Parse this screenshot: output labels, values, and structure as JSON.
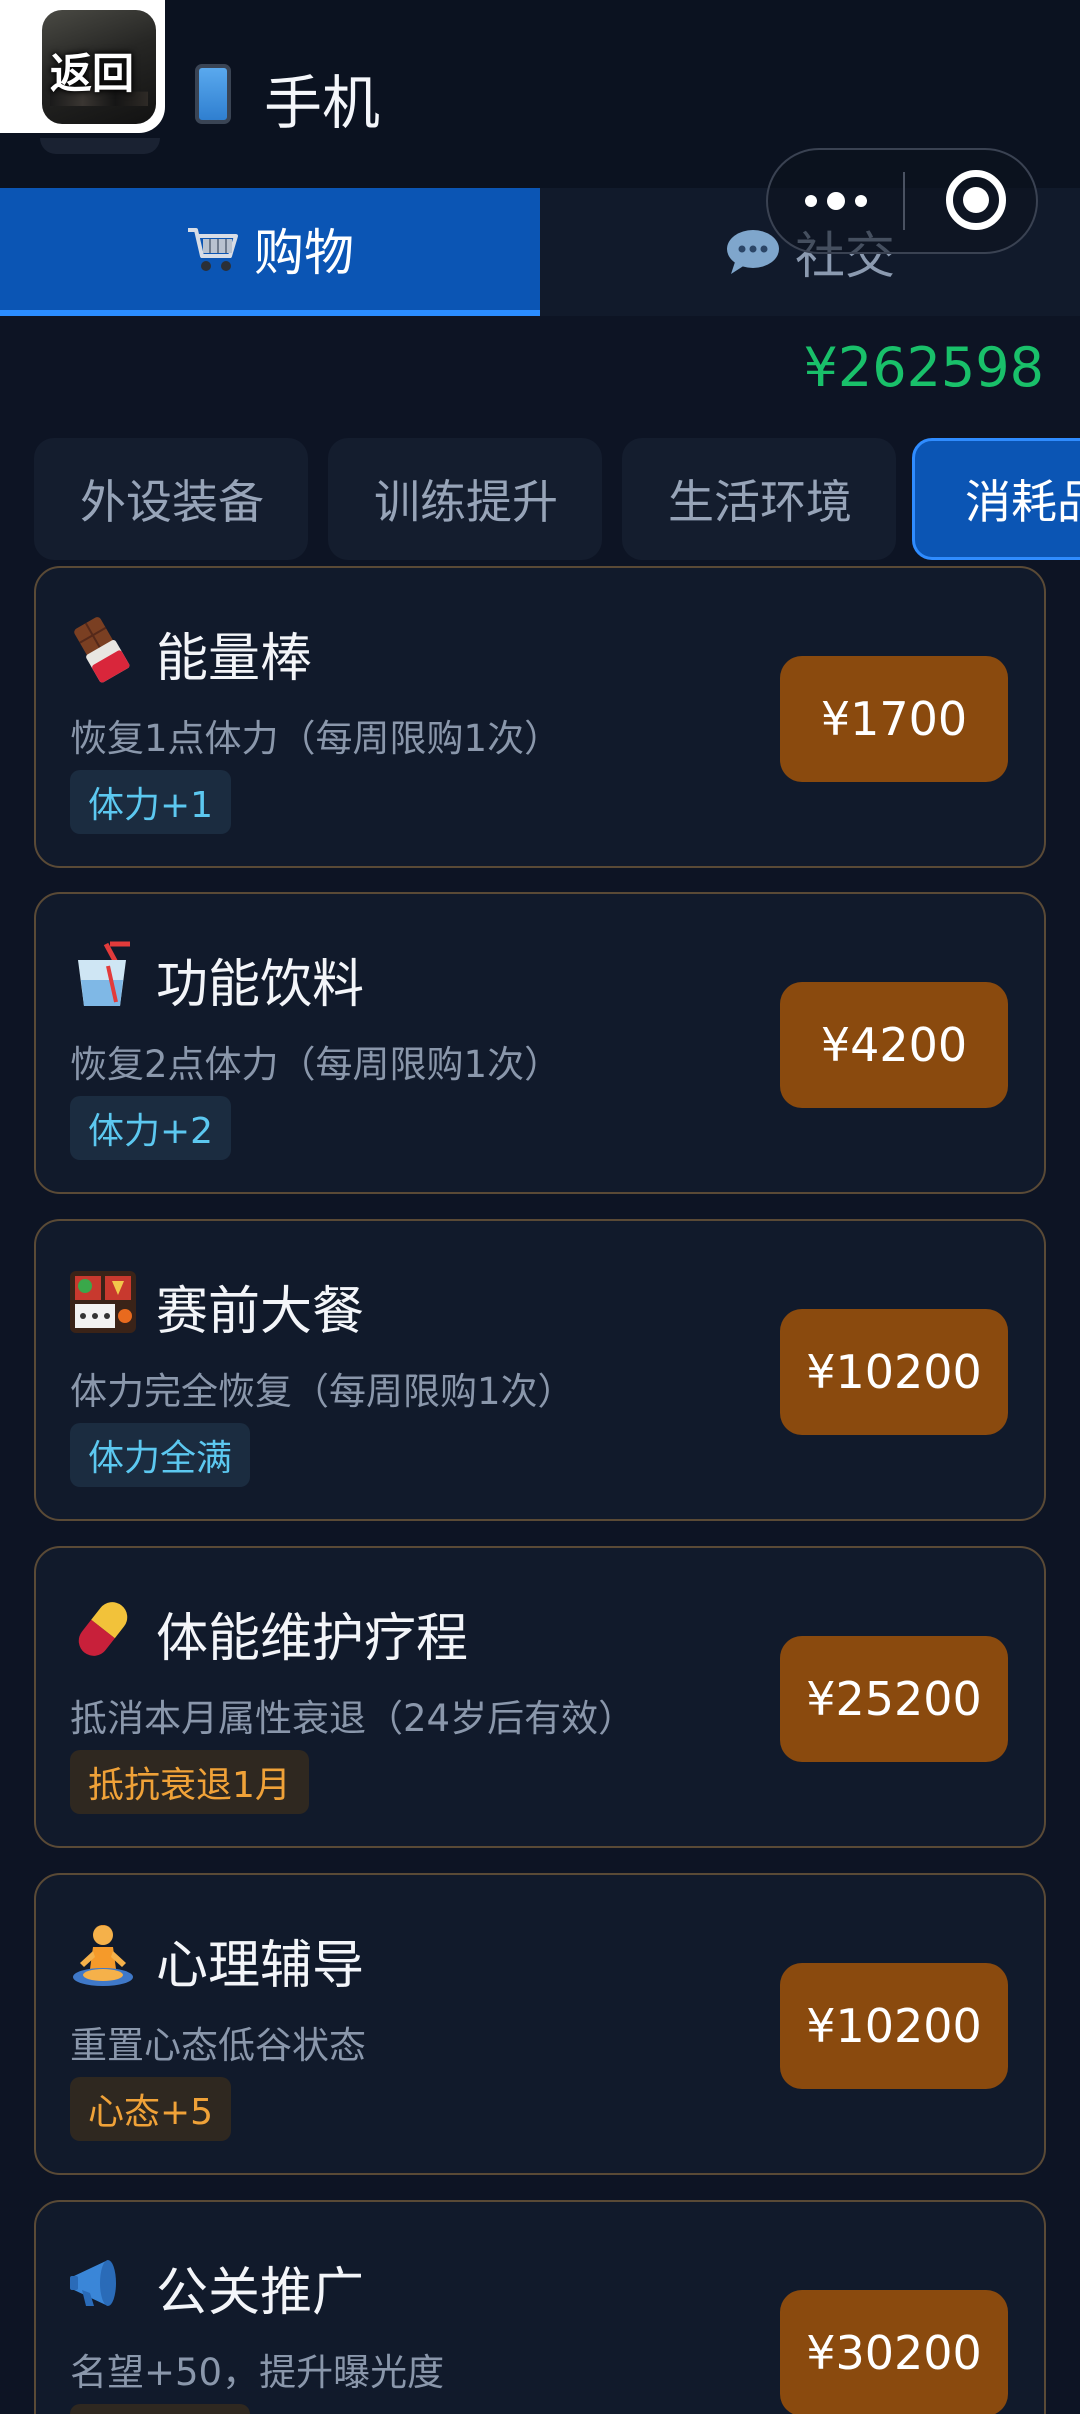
{
  "header": {
    "back_label": "返回",
    "title": "手机",
    "phone_icon": "mobile-phone-icon"
  },
  "main_tabs": [
    {
      "label": "购物",
      "icon": "shopping-cart-icon",
      "active": true
    },
    {
      "label": "社交",
      "icon": "speech-bubble-icon",
      "active": false
    }
  ],
  "balance": "¥262598",
  "categories": [
    {
      "label": "外设装备",
      "active": false
    },
    {
      "label": "训练提升",
      "active": false
    },
    {
      "label": "生活环境",
      "active": false
    },
    {
      "label": "消耗品",
      "active": true
    }
  ],
  "items": [
    {
      "icon": "chocolate-bar-icon",
      "name": "能量棒",
      "desc": "恢复1点体力（每周限购1次）",
      "badge": "体力+1",
      "badge_color": "blue",
      "price": "¥1700"
    },
    {
      "icon": "drink-cup-icon",
      "name": "功能饮料",
      "desc": "恢复2点体力（每周限购1次）",
      "badge": "体力+2",
      "badge_color": "blue",
      "price": "¥4200"
    },
    {
      "icon": "bento-box-icon",
      "name": "赛前大餐",
      "desc": "体力完全恢复（每周限购1次）",
      "badge": "体力全满",
      "badge_color": "blue",
      "price": "¥10200"
    },
    {
      "icon": "pill-icon",
      "name": "体能维护疗程",
      "desc": "抵消本月属性衰退（24岁后有效）",
      "badge": "抵抗衰退1月",
      "badge_color": "orange",
      "price": "¥25200"
    },
    {
      "icon": "meditation-person-icon",
      "name": "心理辅导",
      "desc": "重置心态低谷状态",
      "badge": "心态+5",
      "badge_color": "orange",
      "price": "¥10200"
    },
    {
      "icon": "megaphone-icon",
      "name": "公关推广",
      "desc": "名望+50，提升曝光度",
      "badge": "",
      "badge_color": "orange",
      "price": "¥30200"
    }
  ],
  "colors": {
    "background": "#0d1424",
    "accent_blue": "#0b55b4",
    "price_button": "#8a4a0e",
    "balance_green": "#19c06a",
    "badge_blue_text": "#5cc8f0",
    "badge_orange_text": "#f0a238"
  }
}
